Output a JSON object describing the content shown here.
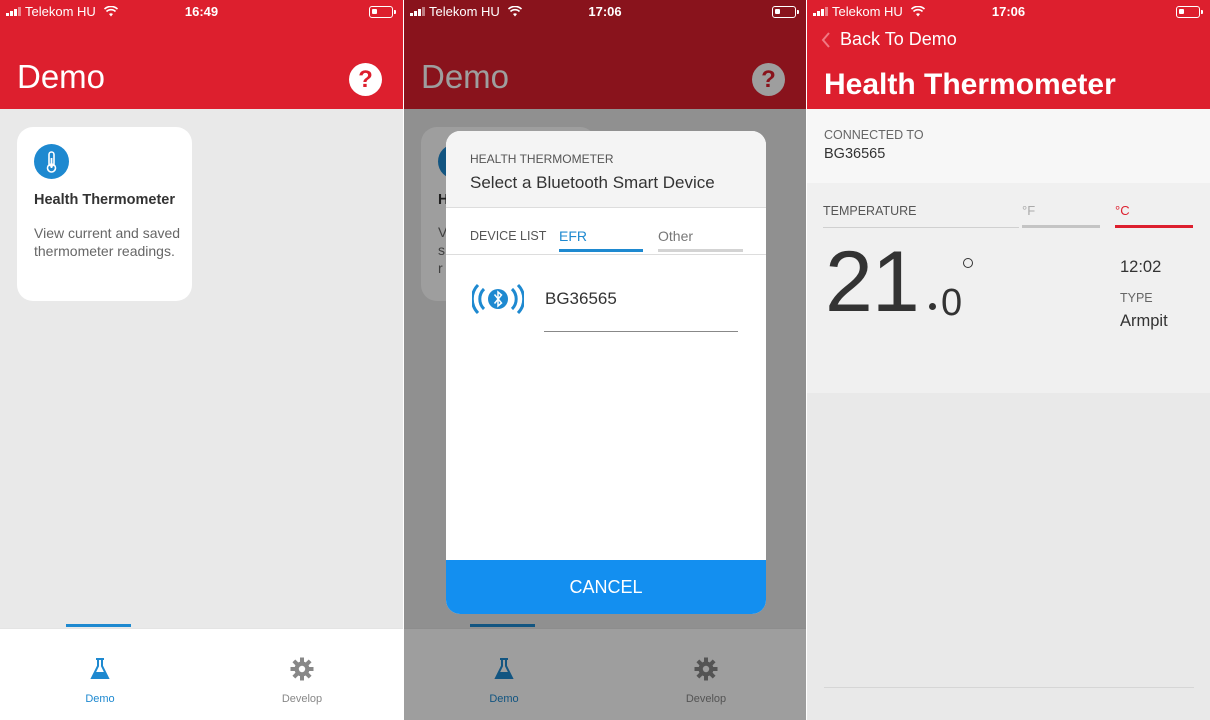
{
  "screens": [
    {
      "status": {
        "carrier": "Telekom HU",
        "time": "16:49"
      },
      "header": {
        "title": "Demo"
      },
      "card": {
        "title": "Health Thermometer",
        "description": "View current and saved thermometer readings."
      },
      "tabs": [
        {
          "label": "Demo"
        },
        {
          "label": "Develop"
        }
      ]
    },
    {
      "status": {
        "carrier": "Telekom HU",
        "time": "17:06"
      },
      "header": {
        "title": "Demo"
      },
      "background_card": {
        "letters": [
          "H",
          "V",
          "s",
          "r"
        ]
      },
      "dialog": {
        "subtitle": "HEALTH THERMOMETER",
        "title": "Select a Bluetooth Smart Device",
        "tab_device_list": "DEVICE LIST",
        "tab_efr": "EFR",
        "tab_other": "Other",
        "devices": [
          {
            "name": "BG36565"
          }
        ],
        "cancel_label": "CANCEL"
      },
      "tabs": [
        {
          "label": "Demo"
        },
        {
          "label": "Develop"
        }
      ]
    },
    {
      "status": {
        "carrier": "Telekom HU",
        "time": "17:06"
      },
      "back_label": "Back To Demo",
      "title": "Health Thermometer",
      "connected": {
        "label": "CONNECTED TO",
        "value": "BG36565"
      },
      "temperature": {
        "label": "TEMPERATURE",
        "unit_f": "°F",
        "unit_c": "°C",
        "integer": "21",
        "decimal": "0",
        "time": "12:02",
        "type_label": "TYPE",
        "type_value": "Armpit"
      }
    }
  ],
  "colors": {
    "accent_red": "#dd1f2e",
    "accent_blue": "#1e89d0",
    "cancel_blue": "#138ff0"
  },
  "icons": [
    "signal-icon",
    "wifi-icon",
    "battery-icon",
    "help-icon",
    "thermometer-icon",
    "flask-icon",
    "gear-icon",
    "bluetooth-icon",
    "chevron-left-icon"
  ]
}
